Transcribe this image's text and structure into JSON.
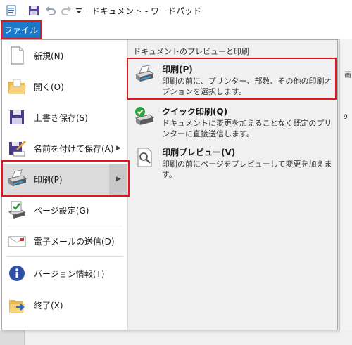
{
  "window": {
    "title": "ドキュメント - ワードパッド"
  },
  "ribbon": {
    "file_tab": "ファイル"
  },
  "right_edge": {
    "fragment_top": "画",
    "fragment_ruler": "9"
  },
  "menu": {
    "items": [
      {
        "label": "新規(N)",
        "icon": "new-document-icon"
      },
      {
        "label": "開く(O)",
        "icon": "open-folder-icon"
      },
      {
        "label": "上書き保存(S)",
        "icon": "save-disk-icon"
      },
      {
        "label": "名前を付けて保存(A)",
        "icon": "save-as-icon",
        "submenu": true
      },
      {
        "label": "印刷(P)",
        "icon": "printer-icon",
        "submenu": true,
        "selected": true
      },
      {
        "label": "ページ設定(G)",
        "icon": "page-setup-icon"
      },
      {
        "label": "電子メールの送信(D)",
        "icon": "email-icon"
      },
      {
        "label": "バージョン情報(T)",
        "icon": "info-icon"
      },
      {
        "label": "終了(X)",
        "icon": "exit-icon"
      }
    ]
  },
  "preview_pane": {
    "heading": "ドキュメントのプレビューと印刷",
    "options": [
      {
        "title": "印刷(P)",
        "description": "印刷の前に、プリンター、部数、その他の印刷オプションを選択します。",
        "icon": "printer-icon"
      },
      {
        "title": "クイック印刷(Q)",
        "description": "ドキュメントに変更を加えることなく既定のプリンターに直接送信します。",
        "icon": "quick-print-icon"
      },
      {
        "title": "印刷プレビュー(V)",
        "description": "印刷の前にページをプレビューして変更を加えます。",
        "icon": "print-preview-icon"
      }
    ]
  },
  "colors": {
    "accent": "#1979ca",
    "highlight": "#e4161b",
    "selected_bg": "#dcdcdc"
  }
}
